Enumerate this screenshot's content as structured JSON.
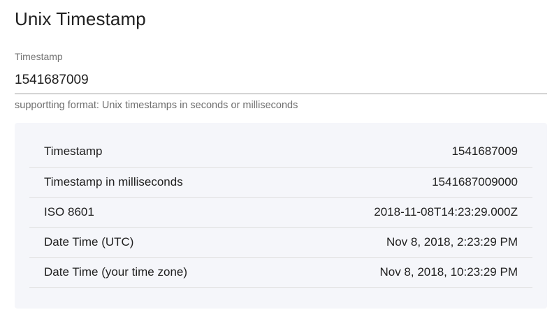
{
  "page": {
    "title": "Unix Timestamp"
  },
  "input": {
    "label": "Timestamp",
    "value": "1541687009",
    "hint": "supportting format: Unix timestamps in seconds or milliseconds"
  },
  "results": [
    {
      "label": "Timestamp",
      "value": "1541687009"
    },
    {
      "label": "Timestamp in milliseconds",
      "value": "1541687009000"
    },
    {
      "label": "ISO 8601",
      "value": "2018-11-08T14:23:29.000Z"
    },
    {
      "label": "Date Time (UTC)",
      "value": "Nov 8, 2018, 2:23:29 PM"
    },
    {
      "label": "Date Time (your time zone)",
      "value": "Nov 8, 2018, 10:23:29 PM"
    }
  ],
  "colors": {
    "card_background": "#f5f6fa",
    "text_primary": "#212121",
    "text_secondary": "#757575",
    "divider": "#e0e0e0"
  }
}
